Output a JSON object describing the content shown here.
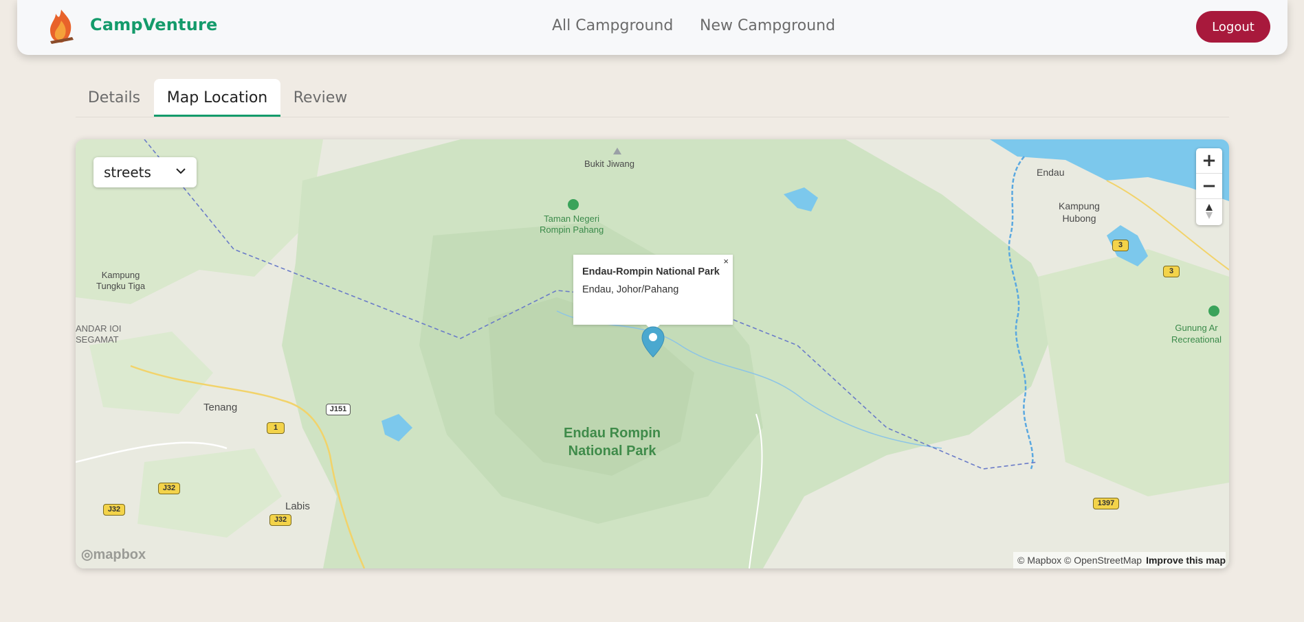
{
  "navbar": {
    "brand": "CampVenture",
    "links": [
      "All Campground",
      "New Campground"
    ],
    "logout_label": "Logout"
  },
  "tabs": [
    "Details",
    "Map Location",
    "Review"
  ],
  "active_tab": "Map Location",
  "map": {
    "style_select": "streets",
    "zoom_in": "+",
    "zoom_out": "−",
    "popup": {
      "title": "Endau-Rompin National Park",
      "subtitle": "Endau, Johor/Pahang",
      "close": "×"
    },
    "labels": {
      "bukit_jiwang": "Bukit Jiwang",
      "taman_negeri_1": "Taman Negeri",
      "taman_negeri_2": "Rompin Pahang",
      "kampung_tungku_1": "Kampung",
      "kampung_tungku_2": "Tungku Tiga",
      "bandar_1": "ANDAR IOI",
      "bandar_2": "SEGAMAT",
      "tenang": "Tenang",
      "labis": "Labis",
      "park_1": "Endau Rompin",
      "park_2": "National Park",
      "endau": "Endau",
      "kampung_hubong_1": "Kampung",
      "kampung_hubong_2": "Hubong",
      "gunung_1": "Gunung Ar",
      "gunung_2": "Recreational"
    },
    "road_shields": {
      "j151": "J151",
      "r1": "1",
      "j32a": "J32",
      "j32b": "J32",
      "j32c": "J32",
      "r3a": "3",
      "r3b": "3",
      "r1397": "1397"
    },
    "attribution": "© Mapbox © OpenStreetMap",
    "improve": "Improve this map",
    "logo_text": "mapbox",
    "colors": {
      "park_green": "#cfe3c3",
      "water": "#7cc8ec",
      "pin": "#4aa8cf"
    }
  }
}
